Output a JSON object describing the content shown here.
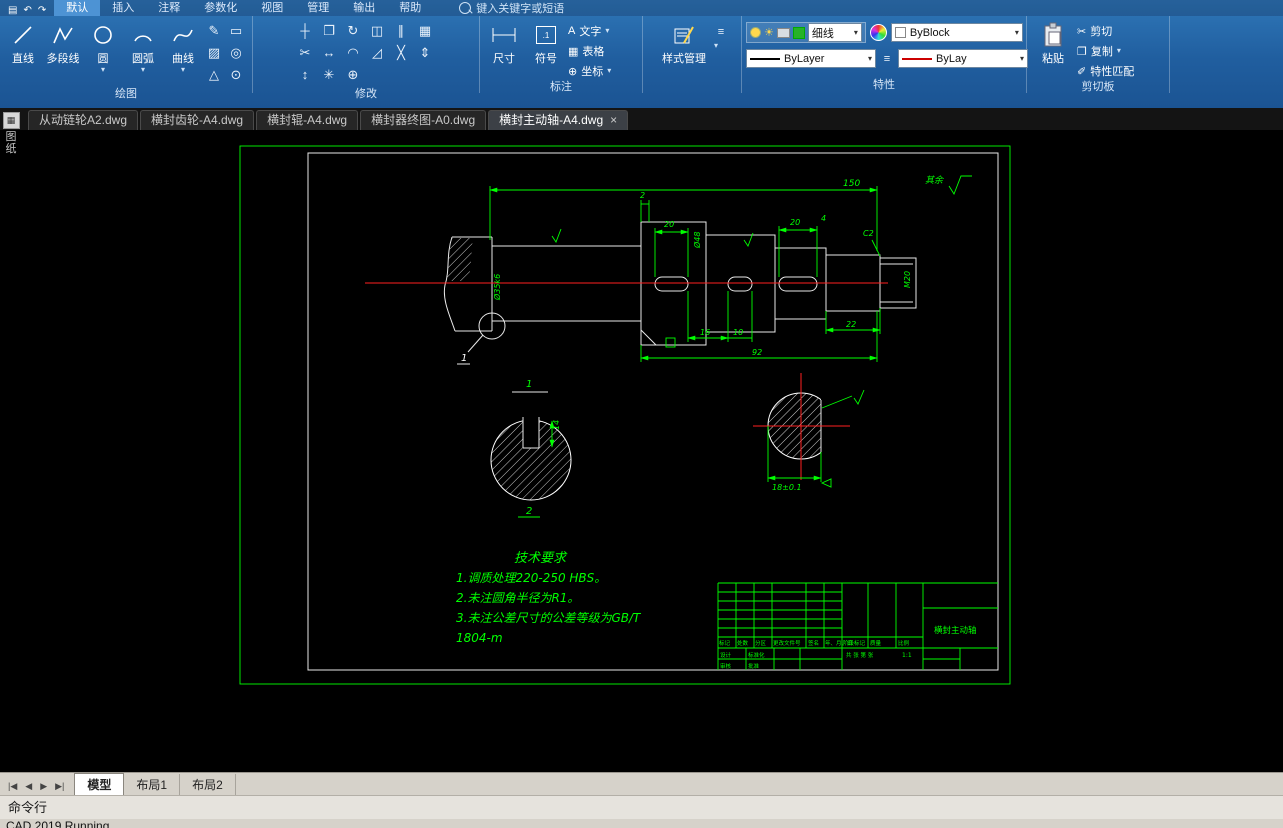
{
  "colors": {
    "ribbon_blue": "#2166a8",
    "draw_green": "#00ff00",
    "centerline_red": "#ff2020"
  },
  "menu": {
    "tabs": [
      {
        "label": "默认",
        "active": true
      },
      {
        "label": "插入"
      },
      {
        "label": "注释"
      },
      {
        "label": "参数化"
      },
      {
        "label": "视图"
      },
      {
        "label": "管理"
      },
      {
        "label": "输出"
      },
      {
        "label": "帮助"
      }
    ],
    "search_placeholder": "键入关键字或短语"
  },
  "ribbon": {
    "draw": {
      "label": "绘图",
      "line": "直线",
      "polyline": "多段线",
      "circle": "圆",
      "arc": "圆弧",
      "spline": "曲线"
    },
    "modify": {
      "label": "修改"
    },
    "annotate": {
      "label": "标注",
      "dim": "尺寸",
      "symbol": "符号",
      "text": "文字",
      "table": "表格",
      "coord": "坐标"
    },
    "style": {
      "button": "样式管理"
    },
    "properties": {
      "label": "特性",
      "lineweight": "细线",
      "color": "ByBlock",
      "linetype": "ByLayer",
      "linetype2": "ByLay"
    },
    "clipboard": {
      "label": "剪切板",
      "paste": "粘贴",
      "cut": "剪切",
      "copy": "复制",
      "match": "特性匹配"
    }
  },
  "file_tabs": [
    {
      "label": "从动链轮A2.dwg"
    },
    {
      "label": "横封齿轮-A4.dwg"
    },
    {
      "label": "横封辊-A4.dwg"
    },
    {
      "label": "横封器终图-A0.dwg"
    },
    {
      "label": "横封主动轴-A4.dwg",
      "active": true
    }
  ],
  "side_tab": {
    "label_char1": "图",
    "label_char2": "纸"
  },
  "drawing": {
    "surplus": "其余",
    "dim_overall": "150",
    "dim_2": "2",
    "dim_20a": "20",
    "dim_20b": "20",
    "dim_4": "4",
    "dim_c2": "C2",
    "dim_16": "16",
    "dim_10": "10",
    "dim_92": "92",
    "dim_22": "22",
    "dia_mid": "Ø35k6",
    "dia_flange": "Ø48",
    "thread": "M20",
    "key_14": "14",
    "key_18": "18±0.1",
    "sec_1": "1",
    "sec_2": "2",
    "tech": {
      "title": "技术要求",
      "line1": "1.调质处理220-250 HBS。",
      "line2": "2.未注圆角半径为R1。",
      "line3": "3.未注公差尺寸的公差等级为GB/T",
      "line4": "1804-m"
    }
  },
  "title_block": {
    "part_title": "横封主动轴",
    "hdr": [
      "标记",
      "处数",
      "分区",
      "更改文件号",
      "签名",
      "年、月、日"
    ],
    "stage": "阶段标记",
    "mass": "质量",
    "scale_label": "比例",
    "scale": "1:1",
    "role_1": "设计",
    "role_2": "标准化",
    "role_3": "审核",
    "role_4": "批准",
    "sheet": "共 张 第 张"
  },
  "bottom": {
    "layout_tabs": [
      {
        "label": "模型",
        "active": true
      },
      {
        "label": "布局1"
      },
      {
        "label": "布局2"
      }
    ],
    "command_label": "命令行",
    "status_partial": "CAD 2019 Running"
  },
  "icons": {
    "caret": "▾",
    "close": "×",
    "save": "▤",
    "undo": "↶",
    "redo": "↷",
    "pencil": "✎",
    "rect": "▭",
    "hatch": "▨",
    "donut": "◎",
    "polygon": "△",
    "point": "⊙",
    "move": "┼",
    "copy": "❐",
    "rotate": "↻",
    "mirror": "◫",
    "offset": "∥",
    "array": "▦",
    "trim": "✂",
    "extend": "↔",
    "fillet": "◠",
    "chamfer": "◿",
    "erase": "╳",
    "scale": "⇕",
    "stretch": "↕",
    "explode": "✳",
    "join": "⊕",
    "textA": "A",
    "table": "▦",
    "menu": "≡",
    "sun": "☀",
    "match": "✐",
    "nav_first": "|◀",
    "nav_prev": "◀",
    "nav_next": "▶",
    "nav_last": "▶|"
  }
}
